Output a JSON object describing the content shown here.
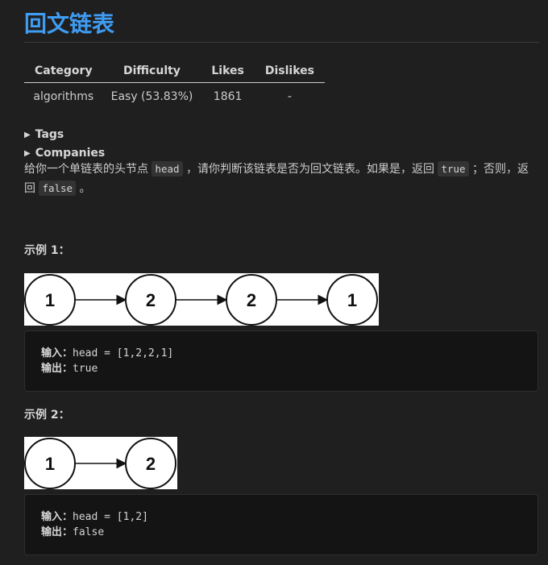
{
  "title": "回文链表",
  "meta": {
    "headers": [
      "Category",
      "Difficulty",
      "Likes",
      "Dislikes"
    ],
    "row": [
      "algorithms",
      "Easy (53.83%)",
      "1861",
      "-"
    ]
  },
  "sections": {
    "tags": "Tags",
    "companies": "Companies"
  },
  "description": {
    "part1": "给你一个单链表的头节点 ",
    "code1": "head",
    "part2": " ，请你判断该链表是否为回文链表。如果是，返回 ",
    "code2": "true",
    "part3": " ；否则，返回 ",
    "code3": "false",
    "part4": " 。"
  },
  "examples": [
    {
      "title": "示例 1：",
      "nodes": [
        "1",
        "2",
        "2",
        "1"
      ],
      "input_label": "输入：",
      "input_value": "head = [1,2,2,1]",
      "output_label": "输出：",
      "output_value": "true"
    },
    {
      "title": "示例 2：",
      "nodes": [
        "1",
        "2"
      ],
      "input_label": "输入：",
      "input_value": "head = [1,2]",
      "output_label": "输出：",
      "output_value": "false"
    }
  ]
}
